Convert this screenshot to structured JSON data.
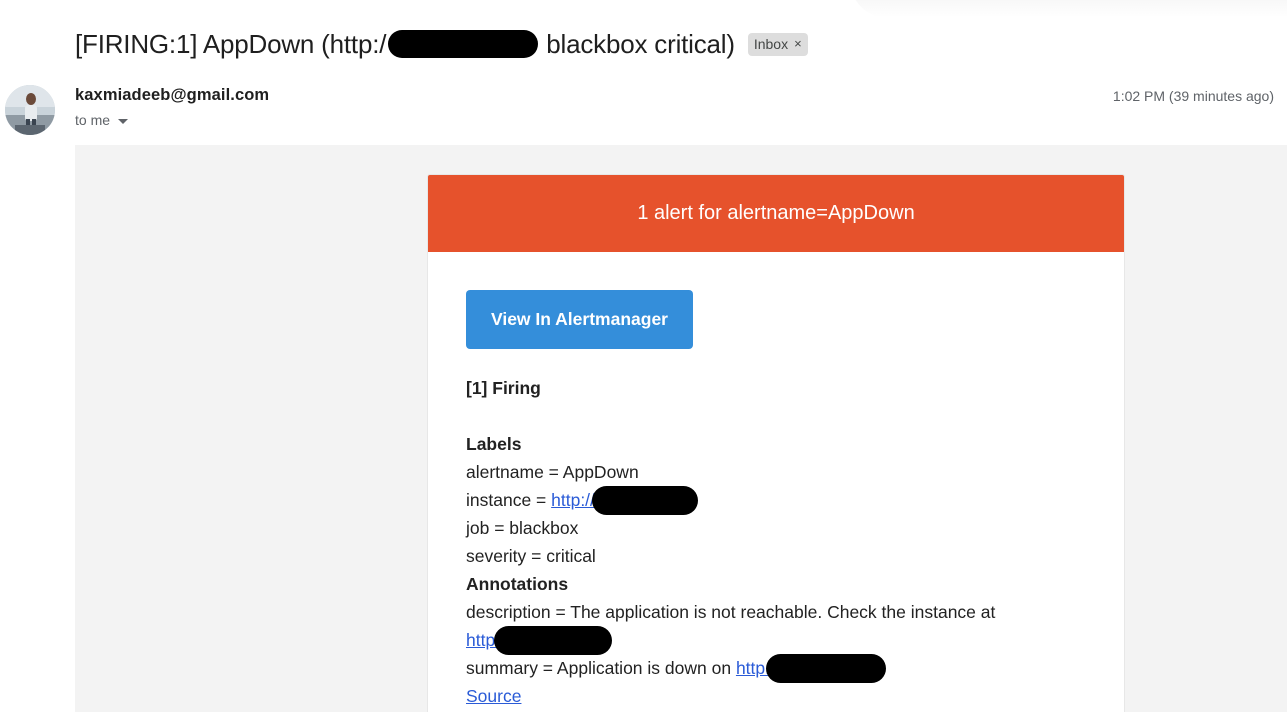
{
  "email": {
    "subject_prefix": "[FIRING:1] AppDown (http:/",
    "subject_suffix": "blackbox critical)",
    "label_chip": "Inbox",
    "label_chip_close": "×",
    "sender": "kaxmiadeeb@gmail.com",
    "recipient": "to me",
    "time": "1:02 PM (39 minutes ago)"
  },
  "alert": {
    "header": "1 alert for alertname=AppDown",
    "button_label": "View In Alertmanager",
    "firing_title": "[1] Firing",
    "labels_heading": "Labels",
    "alertname": "alertname = AppDown",
    "instance_prefix": "instance = ",
    "instance_link": "http://",
    "job": "job = blackbox",
    "severity": "severity = critical",
    "annotations_heading": "Annotations",
    "description": "description = The application is not reachable. Check the instance at",
    "description_link": "http:",
    "summary_prefix": "summary = Application is down on ",
    "summary_link": "http:",
    "source_link": "Source"
  },
  "colors": {
    "header_bg": "#e6522c",
    "button_bg": "#348eda",
    "link": "#2a5bd7",
    "body_bg": "#f3f3f3",
    "chip_bg": "#dddddd"
  }
}
